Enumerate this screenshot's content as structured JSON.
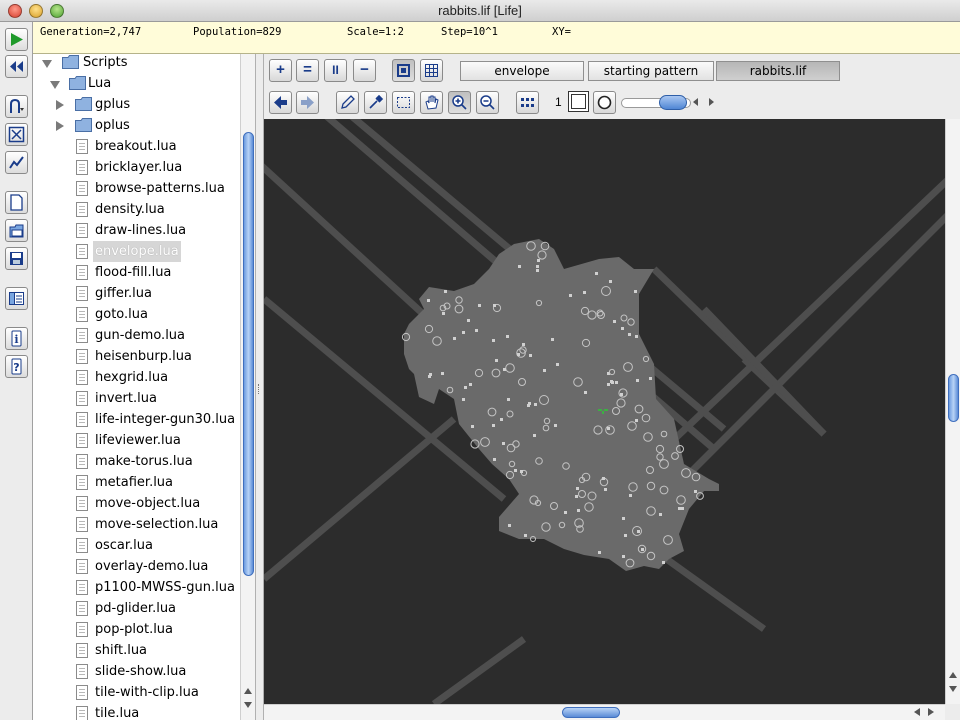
{
  "window": {
    "title": "rabbits.lif [Life]"
  },
  "status": {
    "generation": "Generation=2,747",
    "population": "Population=829",
    "scale": "Scale=1:2",
    "step": "Step=10^1",
    "xy": "XY="
  },
  "toolstrip": {
    "icons": [
      "play-icon",
      "rewind-icon",
      "algorithm-menu-icon",
      "fit-icon",
      "graph-icon",
      "new-pattern-icon",
      "open-pattern-icon",
      "save-pattern-icon",
      "show-files-icon",
      "info-icon",
      "help-icon"
    ]
  },
  "tree": {
    "scripts_label": "Scripts",
    "lua_label": "Lua",
    "folders": [
      "gplus",
      "oplus"
    ],
    "files": [
      "breakout.lua",
      "bricklayer.lua",
      "browse-patterns.lua",
      "density.lua",
      "draw-lines.lua",
      "envelope.lua",
      "flood-fill.lua",
      "giffer.lua",
      "goto.lua",
      "gun-demo.lua",
      "heisenburp.lua",
      "hexgrid.lua",
      "invert.lua",
      "life-integer-gun30.lua",
      "lifeviewer.lua",
      "make-torus.lua",
      "metafier.lua",
      "move-object.lua",
      "move-selection.lua",
      "oscar.lua",
      "overlay-demo.lua",
      "p1100-MWSS-gun.lua",
      "pd-glider.lua",
      "pop-plot.lua",
      "shift.lua",
      "slide-show.lua",
      "tile-with-clip.lua",
      "tile.lua"
    ],
    "selected": "envelope.lua"
  },
  "toolbar": {
    "speed_up": "+",
    "reset_speed": "=",
    "pause": "II",
    "slow_down": "−",
    "tabs": [
      "envelope",
      "starting pattern",
      "rabbits.lif"
    ],
    "active_tab": "rabbits.lif",
    "state_number": "1",
    "slider_fraction": 0.6
  },
  "colors": {
    "status_bg": "#fffcd9",
    "canvas_bg": "#2c2c2c",
    "pattern_gray": "#6a6a6a",
    "cell_light": "#c8c8c8",
    "accent_blue": "#4f86d4"
  }
}
